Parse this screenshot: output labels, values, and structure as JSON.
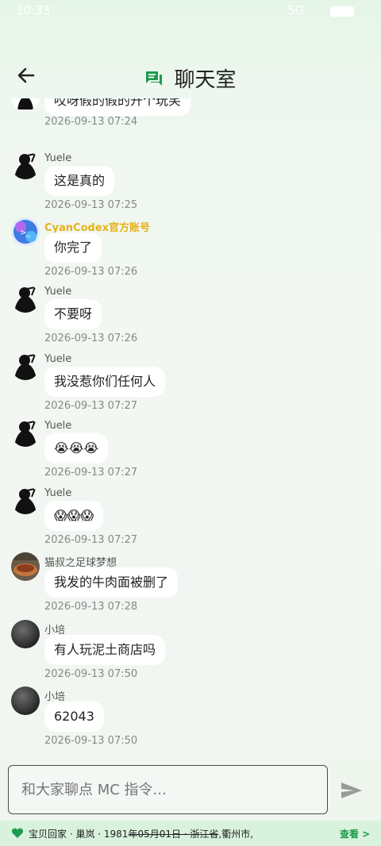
{
  "status_bar": {
    "time": "10:33",
    "network": "5G"
  },
  "header": {
    "title": "聊天室"
  },
  "messages": [
    {
      "sender": "",
      "text": "哎呀假的假的开个玩笑",
      "time": "2026-09-13 07:24",
      "avatar": "yuele"
    },
    {
      "sender": "Yuele",
      "text": "这是真的",
      "time": "2026-09-13 07:25",
      "avatar": "yuele"
    },
    {
      "sender": "CyanCodex官方账号",
      "text": "你完了",
      "time": "2026-09-13 07:26",
      "avatar": "cyancodex"
    },
    {
      "sender": "Yuele",
      "text": "不要呀",
      "time": "2026-09-13 07:26",
      "avatar": "yuele"
    },
    {
      "sender": "Yuele",
      "text": "我没惹你们任何人",
      "time": "2026-09-13 07:27",
      "avatar": "yuele"
    },
    {
      "sender": "Yuele",
      "text": "😭😭😭",
      "time": "2026-09-13 07:27",
      "avatar": "yuele"
    },
    {
      "sender": "Yuele",
      "text": "😱😱😱",
      "time": "2026-09-13 07:27",
      "avatar": "yuele"
    },
    {
      "sender": "猫叔之足球梦想",
      "text": "我发的牛肉面被删了",
      "time": "2026-09-13 07:28",
      "avatar": "cat"
    },
    {
      "sender": "小培",
      "text": "有人玩泥土商店吗",
      "time": "2026-09-13 07:50",
      "avatar": "xiaopei"
    },
    {
      "sender": "小培",
      "text": "62043",
      "time": "2026-09-13 07:50",
      "avatar": "xiaopei"
    }
  ],
  "input": {
    "placeholder": "和大家聊点 MC 指令..."
  },
  "ticker": {
    "text_prefix": "宝贝回家 · 巢岚 · 1981",
    "text_strike": "年05月01日 · 浙江省",
    "text_suffix": ",衢州市,",
    "link": "查看 >"
  },
  "colors": {
    "accent": "#1e9b4e",
    "official_name": "#e7b118"
  }
}
